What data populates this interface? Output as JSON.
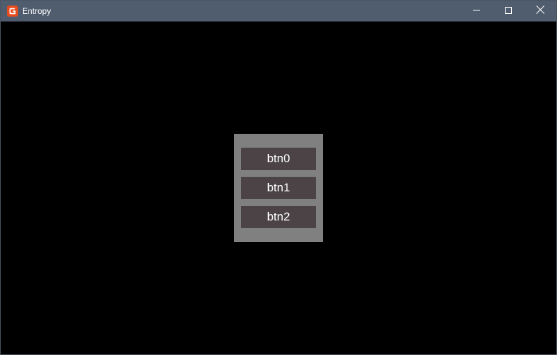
{
  "window": {
    "title": "Entropy",
    "icon": "gamemaker-logo-icon",
    "accent_color": "#e84c1e",
    "titlebar_color": "#505d6e"
  },
  "controls": {
    "minimize_icon": "minimize-icon",
    "maximize_icon": "maximize-icon",
    "close_icon": "close-icon"
  },
  "menu": {
    "panel_color": "#808080",
    "button_color": "#4b4346",
    "buttons": [
      {
        "label": "btn0"
      },
      {
        "label": "btn1"
      },
      {
        "label": "btn2"
      }
    ]
  }
}
